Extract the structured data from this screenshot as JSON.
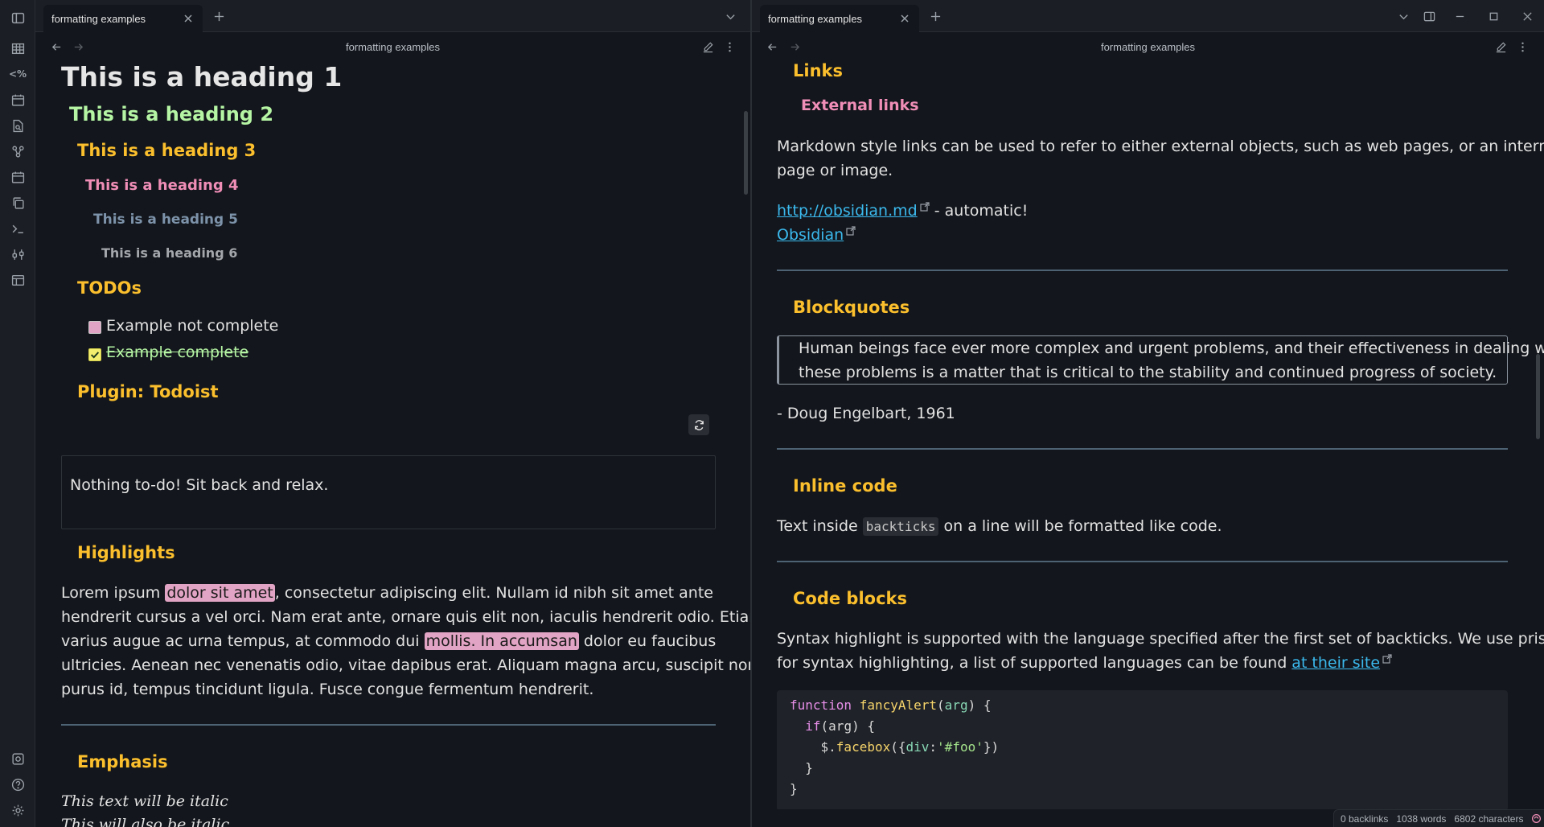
{
  "left_tab": {
    "title": "formatting examples"
  },
  "right_tab": {
    "title": "formatting examples"
  },
  "left_pane": {
    "title": "formatting examples",
    "h1": "This is a heading 1",
    "h2": "This is a heading 2",
    "h3": "This is a heading 3",
    "h4": "This is a heading 4",
    "h5": "This is a heading 5",
    "h6": "This is a heading 6",
    "todos_heading": "TODOs",
    "todo_1": "Example not complete",
    "todo_2": "Example complete",
    "todoist_heading": "Plugin: Todoist",
    "todoist_empty": "Nothing to-do! Sit back and relax.",
    "highlights_heading": "Highlights",
    "hl_text_a": "Lorem ipsum ",
    "hl_mark_1": "dolor sit amet",
    "hl_text_b": ", consectetur adipiscing elit. Nullam id nibh sit amet ante",
    "hl_line_2": "hendrerit cursus a vel orci. Nam erat ante, ornare quis elit non, iaculis hendrerit odio. Etiam",
    "hl_text_c": "varius augue ac urna tempus, at commodo dui ",
    "hl_mark_2": "mollis. In accumsan",
    "hl_text_d": " dolor eu faucibus",
    "hl_line_4": "ultricies. Aenean nec venenatis odio, vitae dapibus erat. Aliquam magna arcu, suscipit non",
    "hl_line_5": "purus id, tempus tincidunt ligula. Fusce congue fermentum hendrerit.",
    "emphasis_heading": "Emphasis",
    "italic_1": "This text will be italic",
    "italic_2": "This will also be italic"
  },
  "right_pane": {
    "title": "formatting examples",
    "links_heading": "Links",
    "external_heading": "External links",
    "links_p1": "Markdown style links can be used to refer to either external objects, such as web pages, or an internal",
    "links_p2": "page or image.",
    "link_1": "http://obsidian.md",
    "link_1_suffix": " - automatic!",
    "link_2": "Obsidian",
    "blockquotes_heading": "Blockquotes",
    "quote_1": "Human beings face ever more complex and urgent problems, and their effectiveness in dealing with",
    "quote_2": "these problems is a matter that is critical to the stability and continued progress of society.",
    "quote_attrib": "- Doug Engelbart, 1961",
    "inline_heading": "Inline code",
    "inline_a": "Text inside ",
    "inline_code": "backticks",
    "inline_b": " on a line will be formatted like code.",
    "codeblocks_heading": "Code blocks",
    "code_p1": "Syntax highlight is supported with the language specified after the first set of backticks. We use prismjs",
    "code_p2": "for syntax highlighting, a list of supported languages can be found ",
    "code_link": "at their site"
  },
  "code": {
    "l1_kw": "function",
    "l1_fn": "fancyAlert",
    "l1_arg": "arg",
    "l2_kw": "if",
    "l2_arg": "arg",
    "l3_obj": "$.",
    "l3_fn": "facebox",
    "l3_key": "div",
    "l3_str": "'#foo'"
  },
  "status": {
    "backlinks": "0 backlinks",
    "words": "1038 words",
    "chars": "6802 characters"
  },
  "colors": {
    "h1": "#e6e6e6",
    "h2": "#b5f5a4",
    "h3": "#fbbf2d",
    "h4": "#f08eb7",
    "h5": "#7d93aa",
    "h6": "#a4a7ab",
    "highlight": "#e2a4c4",
    "link": "#3bb9ed",
    "background": "#13161c"
  }
}
